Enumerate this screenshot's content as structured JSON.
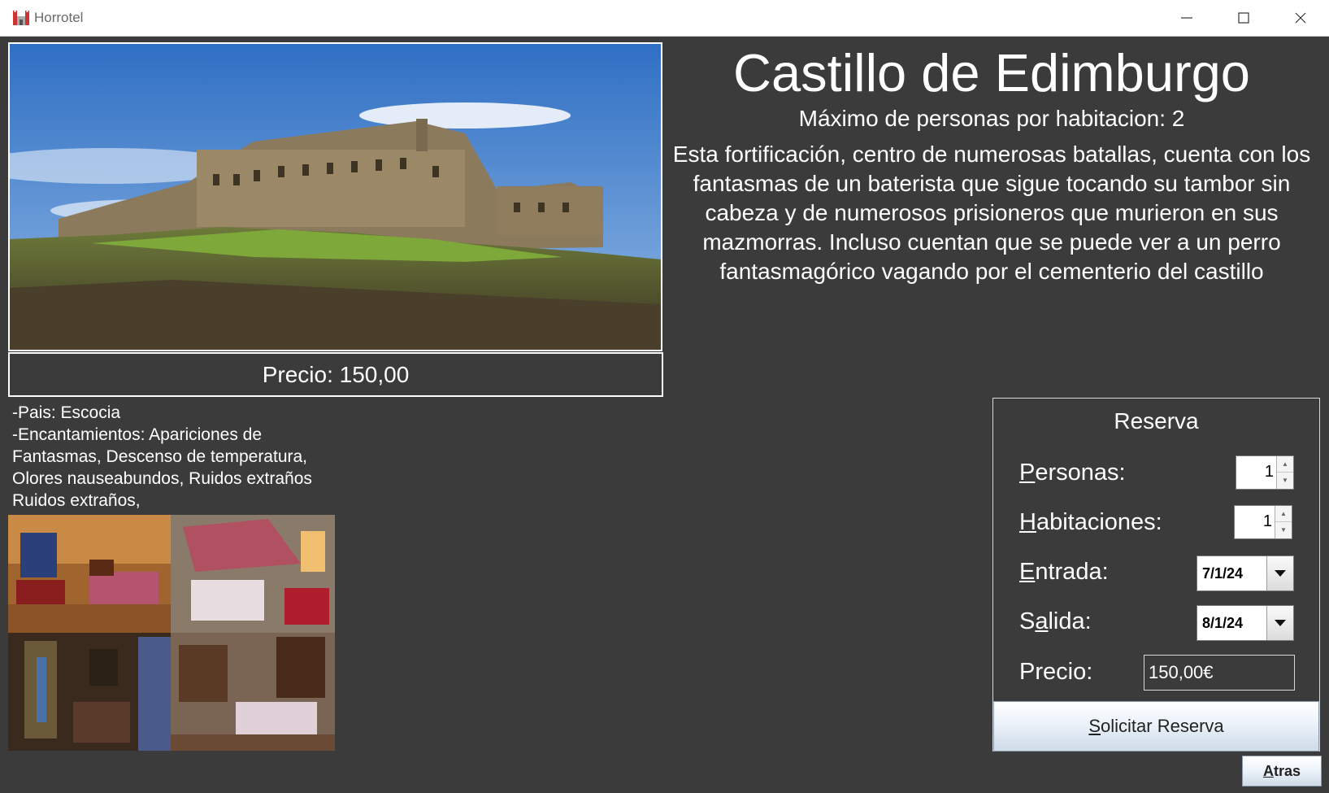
{
  "window": {
    "title": "Horrotel",
    "icon": "castle-icon",
    "controls": [
      "minimize-icon",
      "maximize-icon",
      "close-icon"
    ]
  },
  "hotel": {
    "name": "Castillo de Edimburgo",
    "max_persons": "Máximo de personas por habitacion: 2",
    "description": "Esta fortificación, centro de numerosas batallas, cuenta con los fantasmas de un baterista que sigue tocando su tambor sin cabeza y de  numerosos prisioneros que murieron en sus mazmorras. Incluso cuentan que se puede ver a un perro fantasmagórico vagando por el cementerio del castillo",
    "price": "Precio: 150,00",
    "country": "-Pais: Escocia",
    "enchantments": "-Encantamientos: Apariciones de Fantasmas, Descenso de temperatura, Olores nauseabundos, Ruidos extraños Ruidos extraños,"
  },
  "reserva": {
    "title": "Reserva",
    "personas": {
      "mnemonic": "P",
      "rest": "ersonas:",
      "value": "1"
    },
    "habitaciones": {
      "mnemonic": "H",
      "rest": "abitaciones:",
      "value": "1"
    },
    "entrada": {
      "mnemonic": "E",
      "rest": "ntrada:",
      "value": "7/1/24"
    },
    "salida": {
      "pre": "S",
      "mnemonic": "a",
      "rest": "lida:",
      "value": "8/1/24"
    },
    "precio": {
      "label": "Precio:",
      "value": "150,00€"
    },
    "submit": {
      "mnemonic": "S",
      "rest": "olicitar Reserva"
    }
  },
  "back_button": {
    "mnemonic": "A",
    "rest": "tras"
  },
  "colors": {
    "background": "#3b3b3b",
    "text": "#ffffff",
    "button_gradient_end": "#cfdbe8"
  }
}
